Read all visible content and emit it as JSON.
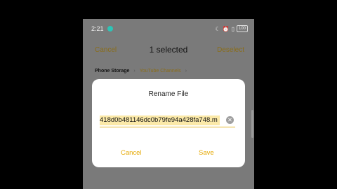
{
  "status_bar": {
    "time": "2:21",
    "battery": "100"
  },
  "header": {
    "cancel_label": "Cancel",
    "title": "1 selected",
    "deselect_label": "Deselect"
  },
  "breadcrumb": {
    "root": "Phone Storage",
    "separator": "›",
    "current": "YouTube Channels",
    "trail": "›"
  },
  "dialog": {
    "title": "Rename File",
    "filename_value": "418d0b481146dc0b79fe94a428fa748.m",
    "cancel_label": "Cancel",
    "save_label": "Save"
  },
  "colors": {
    "accent": "#e5a800",
    "dimmed_accent": "#8a6d1a",
    "overlay": "#7a7a7a"
  }
}
